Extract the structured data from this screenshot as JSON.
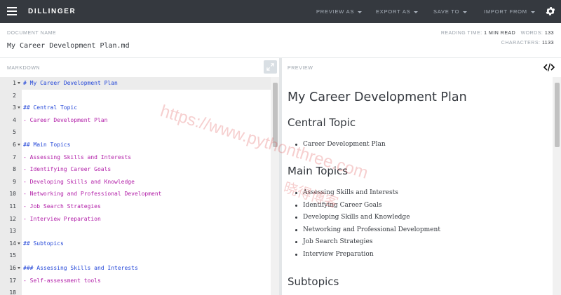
{
  "app": {
    "brand": "DILLINGER",
    "nav": [
      {
        "label": "PREVIEW AS"
      },
      {
        "label": "EXPORT AS"
      },
      {
        "label": "SAVE TO"
      },
      {
        "label": "IMPORT FROM"
      }
    ],
    "menu_icon": "hamburger-icon",
    "settings_icon": "gear-icon"
  },
  "document": {
    "name_label": "DOCUMENT NAME",
    "name_value": "My Career Development Plan.md",
    "reading_time_label": "READING TIME:",
    "reading_time_value": "1 MIN READ",
    "words_label": "WORDS:",
    "words_value": "133",
    "characters_label": "CHARACTERS:",
    "characters_value": "1133"
  },
  "editor": {
    "label": "MARKDOWN",
    "expand_icon": "expand-icon",
    "lines": [
      {
        "num": "1",
        "text": "# My Career Development Plan",
        "kind": "heading",
        "fold": true
      },
      {
        "num": "2",
        "text": "",
        "kind": "plain",
        "fold": false
      },
      {
        "num": "3",
        "text": "## Central Topic",
        "kind": "heading",
        "fold": true
      },
      {
        "num": "4",
        "text": "- Career Development Plan",
        "kind": "list",
        "fold": false
      },
      {
        "num": "5",
        "text": "",
        "kind": "plain",
        "fold": false
      },
      {
        "num": "6",
        "text": "## Main Topics",
        "kind": "heading",
        "fold": true
      },
      {
        "num": "7",
        "text": "- Assessing Skills and Interests",
        "kind": "list",
        "fold": false
      },
      {
        "num": "8",
        "text": "- Identifying Career Goals",
        "kind": "list",
        "fold": false
      },
      {
        "num": "9",
        "text": "- Developing Skills and Knowledge",
        "kind": "list",
        "fold": false
      },
      {
        "num": "10",
        "text": "- Networking and Professional Development",
        "kind": "list",
        "fold": false
      },
      {
        "num": "11",
        "text": "- Job Search Strategies",
        "kind": "list",
        "fold": false
      },
      {
        "num": "12",
        "text": "- Interview Preparation",
        "kind": "list",
        "fold": false
      },
      {
        "num": "13",
        "text": "",
        "kind": "plain",
        "fold": false
      },
      {
        "num": "14",
        "text": "## Subtopics",
        "kind": "heading",
        "fold": true
      },
      {
        "num": "15",
        "text": "",
        "kind": "plain",
        "fold": false
      },
      {
        "num": "16",
        "text": "### Assessing Skills and Interests",
        "kind": "heading",
        "fold": true
      },
      {
        "num": "17",
        "text": "- Self-assessment tools",
        "kind": "list",
        "fold": false
      },
      {
        "num": "18",
        "text": "",
        "kind": "plain",
        "fold": false
      }
    ]
  },
  "preview": {
    "label": "PREVIEW",
    "code_icon": "code-icon",
    "title": "My Career Development Plan",
    "sections": [
      {
        "heading": "Central Topic",
        "items": [
          "Career Development Plan"
        ]
      },
      {
        "heading": "Main Topics",
        "items": [
          "Assessing Skills and Interests",
          "Identifying Career Goals",
          "Developing Skills and Knowledge",
          "Networking and Professional Development",
          "Job Search Strategies",
          "Interview Preparation"
        ]
      },
      {
        "heading": "Subtopics",
        "items": []
      }
    ]
  },
  "watermark": {
    "url": "https://www.pythonthree.com",
    "cn": "晓得博客"
  },
  "colors": {
    "topbar": "#35393f",
    "heading_syntax": "#2346d8",
    "list_syntax": "#b21fa8",
    "watermark": "#d63030"
  }
}
